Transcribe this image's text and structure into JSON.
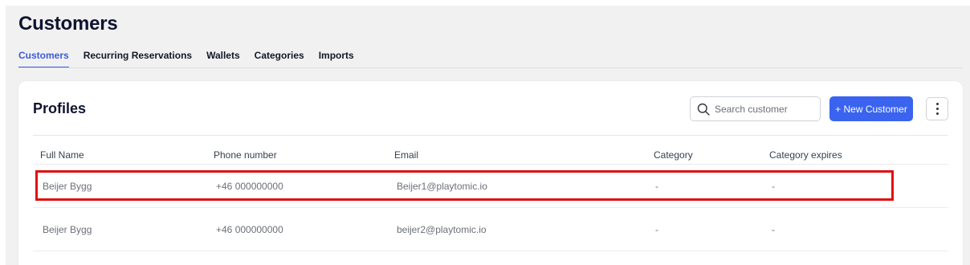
{
  "page": {
    "title": "Customers"
  },
  "tabs": [
    {
      "label": "Customers",
      "active": true
    },
    {
      "label": "Recurring Reservations",
      "active": false
    },
    {
      "label": "Wallets",
      "active": false
    },
    {
      "label": "Categories",
      "active": false
    },
    {
      "label": "Imports",
      "active": false
    }
  ],
  "profiles": {
    "title": "Profiles",
    "search": {
      "placeholder": "Search customer",
      "value": "",
      "icon": "search-icon"
    },
    "new_button_label": "+ New Customer",
    "more_icon": "kebab-vertical-icon"
  },
  "table": {
    "columns": [
      "Full Name",
      "Phone number",
      "Email",
      "Category",
      "Category expires"
    ],
    "rows": [
      {
        "name": "Beijer Bygg",
        "phone": "+46 000000000",
        "email": "Beijer1@playtomic.io",
        "category": "-",
        "expires": "-",
        "highlighted": true
      },
      {
        "name": "Beijer Bygg",
        "phone": "+46 000000000",
        "email": "beijer2@playtomic.io",
        "category": "-",
        "expires": "-",
        "highlighted": false
      }
    ]
  },
  "colors": {
    "accent": "#3a63f0",
    "tab_active": "#3b5bdb",
    "highlight": "#e01010"
  }
}
